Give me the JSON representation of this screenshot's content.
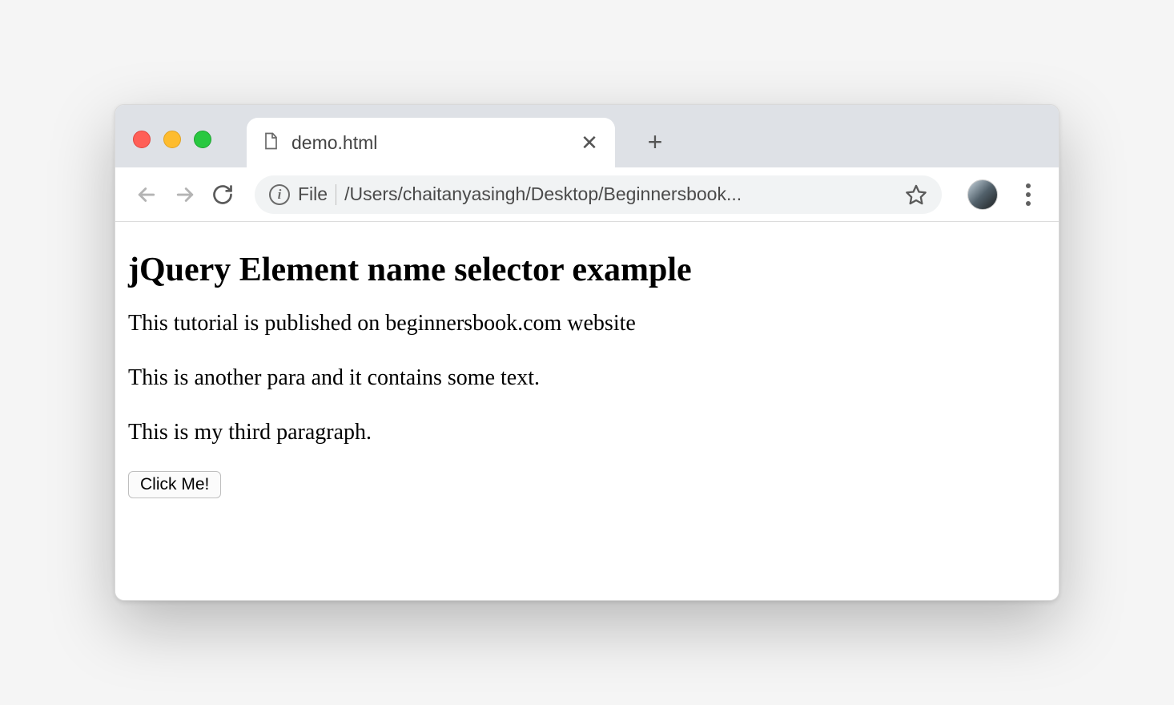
{
  "tab": {
    "title": "demo.html"
  },
  "omnibox": {
    "scheme_label": "File",
    "url_display": "/Users/chaitanyasingh/Desktop/Beginnersbook..."
  },
  "page": {
    "heading": "jQuery Element name selector example",
    "paragraph1": "This tutorial is published on beginnersbook.com website",
    "paragraph2": "This is another para and it contains some text.",
    "paragraph3": "This is my third paragraph.",
    "button_label": "Click Me!"
  }
}
